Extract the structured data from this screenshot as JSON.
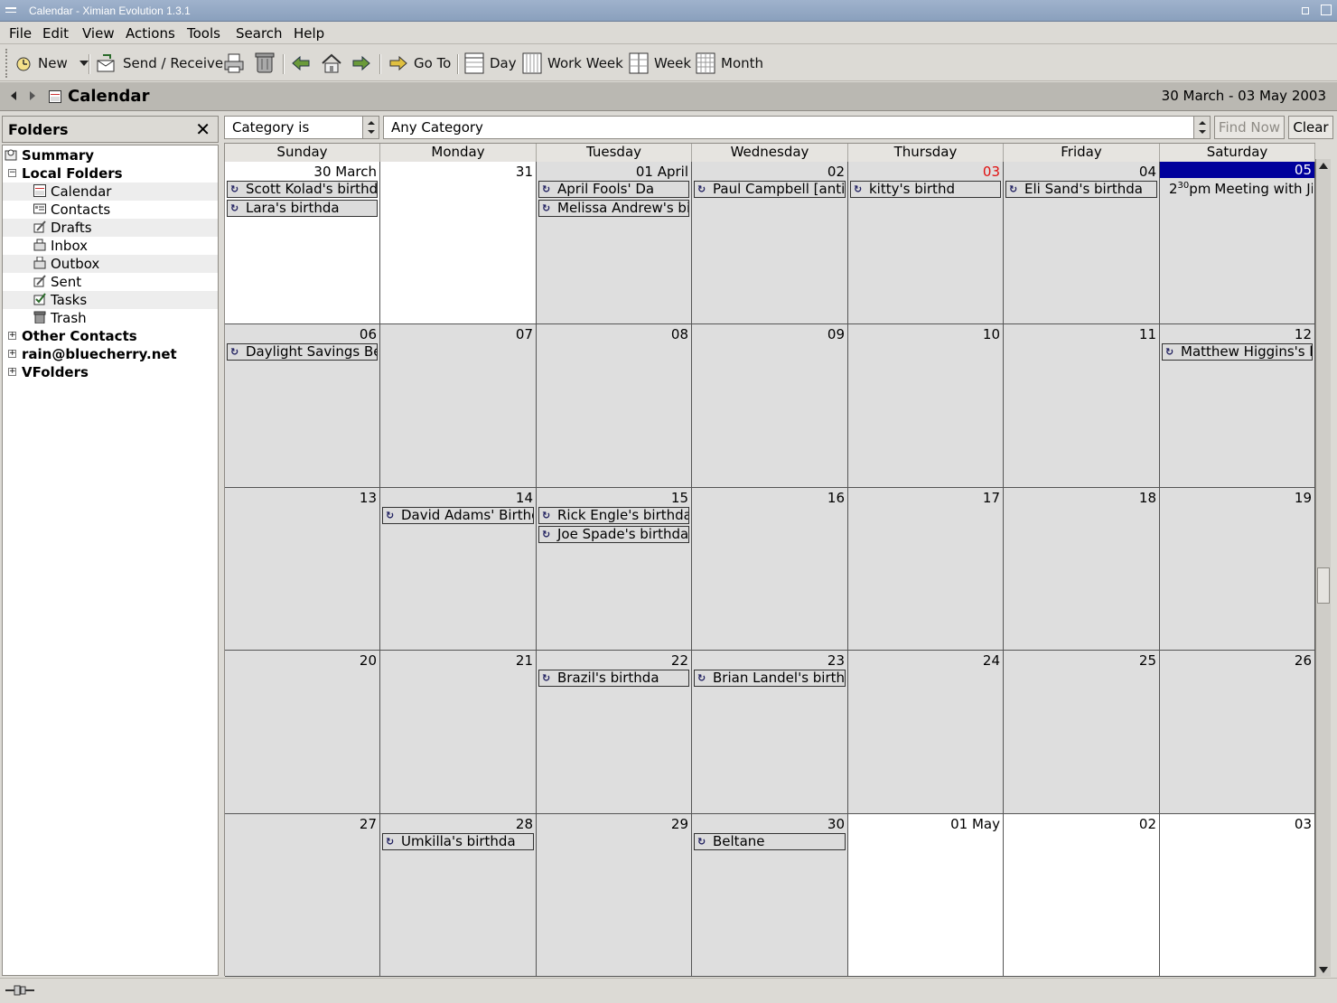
{
  "window": {
    "title": "Calendar - Ximian Evolution 1.3.1"
  },
  "menu": [
    "File",
    "Edit",
    "View",
    "Actions",
    "Tools",
    "Search",
    "Help"
  ],
  "toolbar": {
    "new_label": "New",
    "send_receive_label": "Send / Receive",
    "goto_label": "Go To",
    "day_label": "Day",
    "workweek_label": "Work Week",
    "week_label": "Week",
    "month_label": "Month"
  },
  "header": {
    "title": "Calendar",
    "date_range": "30 March - 03 May 2003"
  },
  "folders": {
    "title": "Folders",
    "close_glyph": "✕",
    "items": [
      {
        "label": "Summary"
      },
      {
        "label": "Local Folders"
      },
      {
        "label": "Calendar"
      },
      {
        "label": "Contacts"
      },
      {
        "label": "Drafts"
      },
      {
        "label": "Inbox"
      },
      {
        "label": "Outbox"
      },
      {
        "label": "Sent"
      },
      {
        "label": "Tasks"
      },
      {
        "label": "Trash"
      },
      {
        "label": "Other Contacts"
      },
      {
        "label": "rain@bluecherry.net"
      },
      {
        "label": "VFolders"
      }
    ]
  },
  "filter": {
    "category_op": "Category is",
    "category_value": "Any Category",
    "find_now_label": "Find Now",
    "clear_label": "Clear"
  },
  "calendar": {
    "days": [
      "Sunday",
      "Monday",
      "Tuesday",
      "Wednesday",
      "Thursday",
      "Friday",
      "Saturday"
    ],
    "weeks": [
      [
        {
          "date": "30 March",
          "events": [
            "Scott Kolad's birthd",
            "Lara's birthda"
          ]
        },
        {
          "date": "31",
          "events": []
        },
        {
          "date": "01 April",
          "events": [
            "April Fools' Da",
            "Melissa Andrew's bir"
          ]
        },
        {
          "date": "02",
          "events": [
            "Paul Campbell [antihe"
          ]
        },
        {
          "date": "03",
          "events": [
            "kitty's birthd"
          ]
        },
        {
          "date": "04",
          "events": [
            "Eli Sand's birthda"
          ]
        },
        {
          "date": "05",
          "events": [],
          "timed": "Meeting with Jim"
        }
      ],
      [
        {
          "date": "06",
          "events": [
            "Daylight Savings Beg"
          ]
        },
        {
          "date": "07",
          "events": []
        },
        {
          "date": "08",
          "events": []
        },
        {
          "date": "09",
          "events": []
        },
        {
          "date": "10",
          "events": []
        },
        {
          "date": "11",
          "events": []
        },
        {
          "date": "12",
          "events": [
            "Matthew Higgins's bi"
          ]
        }
      ],
      [
        {
          "date": "13",
          "events": []
        },
        {
          "date": "14",
          "events": [
            "David Adams' Birthd"
          ]
        },
        {
          "date": "15",
          "events": [
            "Rick Engle's birthda",
            "Joe Spade's birthda"
          ]
        },
        {
          "date": "16",
          "events": []
        },
        {
          "date": "17",
          "events": []
        },
        {
          "date": "18",
          "events": []
        },
        {
          "date": "19",
          "events": []
        }
      ],
      [
        {
          "date": "20",
          "events": []
        },
        {
          "date": "21",
          "events": []
        },
        {
          "date": "22",
          "events": [
            "Brazil's birthda"
          ]
        },
        {
          "date": "23",
          "events": [
            "Brian Landel's birthd"
          ]
        },
        {
          "date": "24",
          "events": []
        },
        {
          "date": "25",
          "events": []
        },
        {
          "date": "26",
          "events": []
        }
      ],
      [
        {
          "date": "27",
          "events": []
        },
        {
          "date": "28",
          "events": [
            "Umkilla's birthda"
          ]
        },
        {
          "date": "29",
          "events": []
        },
        {
          "date": "30",
          "events": [
            "Beltane"
          ]
        },
        {
          "date": "01 May",
          "events": []
        },
        {
          "date": "02",
          "events": []
        },
        {
          "date": "03",
          "events": []
        }
      ]
    ],
    "timed_event_hour": "2",
    "timed_event_minute": "30",
    "timed_event_suffix": "pm",
    "colors": {
      "today": "#00009c",
      "weekend_red": "#e01010",
      "in_month": "#dedede",
      "out_month": "#ffffff"
    }
  }
}
